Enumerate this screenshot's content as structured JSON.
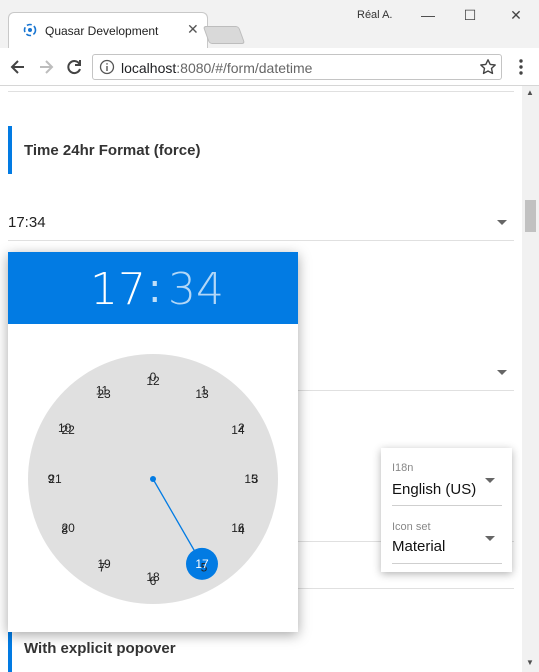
{
  "browser": {
    "tab_title": "Quasar Development",
    "tab_close": "✕",
    "window_user": "Réal A.",
    "window_buttons": {
      "minimize": "—",
      "maximize": "☐",
      "close": "✕"
    },
    "url_host": "localhost",
    "url_path": ":8080/#/form/datetime"
  },
  "page": {
    "section_1_title": "Time 24hr Format (force)",
    "field_1_value": "17:34",
    "section_2_title": "With explicit popover"
  },
  "time_picker": {
    "hour": "17",
    "separator": ":",
    "minute": "34",
    "selected_hour": 17,
    "accent_color": "#027be3",
    "dial_color": "#e0e0e0",
    "outer_hours": [
      "0",
      "1",
      "2",
      "3",
      "4",
      "5",
      "6",
      "7",
      "8",
      "9",
      "10",
      "11"
    ],
    "inner_hours": [
      "12",
      "13",
      "14",
      "15",
      "16",
      "17",
      "18",
      "19",
      "20",
      "21",
      "22",
      "23"
    ]
  },
  "settings_popup": {
    "i18n_label": "I18n",
    "i18n_value": "English (US)",
    "iconset_label": "Icon set",
    "iconset_value": "Material"
  }
}
